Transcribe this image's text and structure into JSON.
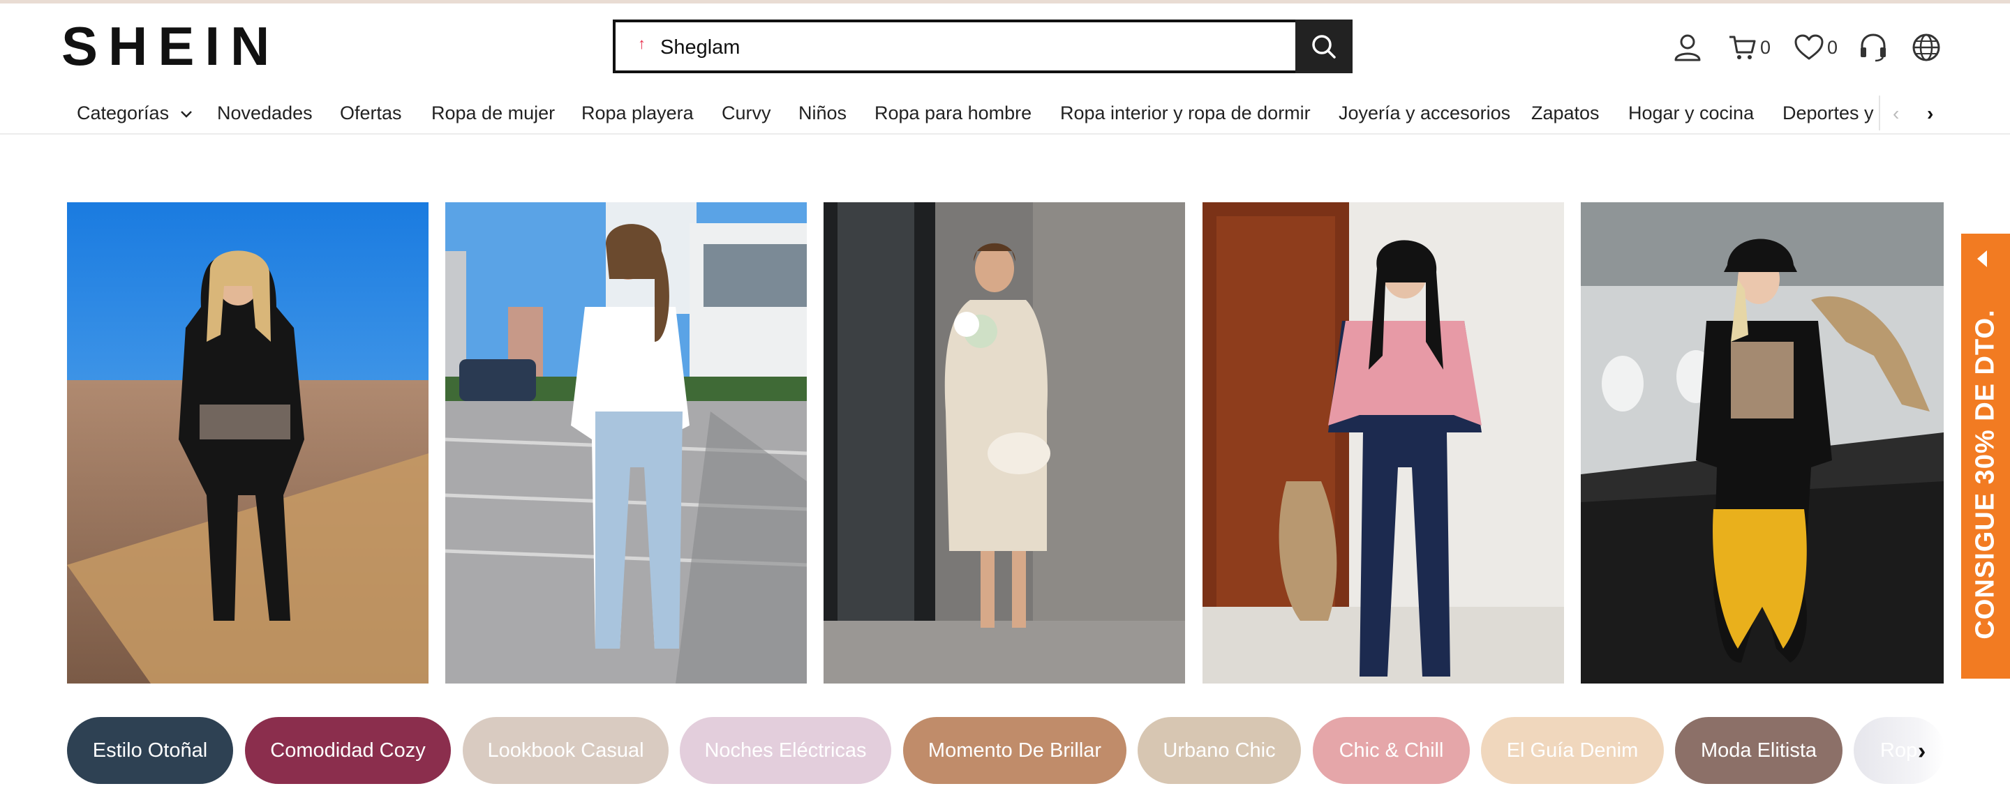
{
  "brand": {
    "logo_text": "SHEIN"
  },
  "search": {
    "query": "Sheglam",
    "hot_mark": "↑"
  },
  "header_actions": {
    "cart_count": "0",
    "wishlist_count": "0"
  },
  "nav": {
    "items": [
      "Categorías",
      "Novedades",
      "Ofertas",
      "Ropa de mujer",
      "Ropa playera",
      "Curvy",
      "Niños",
      "Ropa para hombre",
      "Ropa interior y ropa de dormir",
      "Joyería y accesorios",
      "Zapatos",
      "Hogar y cocina",
      "Deportes y"
    ],
    "prev_arrow": "‹",
    "next_arrow": "›"
  },
  "banner": {
    "photos": [
      "outfit-photo-1",
      "outfit-photo-2",
      "outfit-photo-3",
      "outfit-photo-4",
      "outfit-photo-5"
    ]
  },
  "promo_tab": {
    "label": "CONSIGUE 30% DE DTO."
  },
  "style_pills": {
    "items": [
      {
        "label": "Estilo Otoñal",
        "bg": "#2e4153",
        "color": "#ffffff"
      },
      {
        "label": "Comodidad Cozy",
        "bg": "#8b2e4d",
        "color": "#ffffff"
      },
      {
        "label": "Lookbook Casual",
        "bg": "#d9cbc1",
        "color": "#ffffff"
      },
      {
        "label": "Noches Eléctricas",
        "bg": "#e3cedc",
        "color": "#ffffff"
      },
      {
        "label": "Momento De Brillar",
        "bg": "#c08c6a",
        "color": "#ffffff"
      },
      {
        "label": "Urbano Chic",
        "bg": "#d7c6b2",
        "color": "#ffffff"
      },
      {
        "label": "Chic & Chill",
        "bg": "#e5a6a9",
        "color": "#ffffff"
      },
      {
        "label": "El Guía Denim",
        "bg": "#f0d7bd",
        "color": "#ffffff"
      },
      {
        "label": "Moda Elitista",
        "bg": "#8c7068",
        "color": "#ffffff"
      },
      {
        "label": "Rop",
        "bg": "#e6e6ec",
        "color": "#ffffff"
      }
    ],
    "next_arrow": "›"
  },
  "colors": {
    "promo": "#f27b22",
    "hot": "#e8324f",
    "search_border": "#111111"
  }
}
